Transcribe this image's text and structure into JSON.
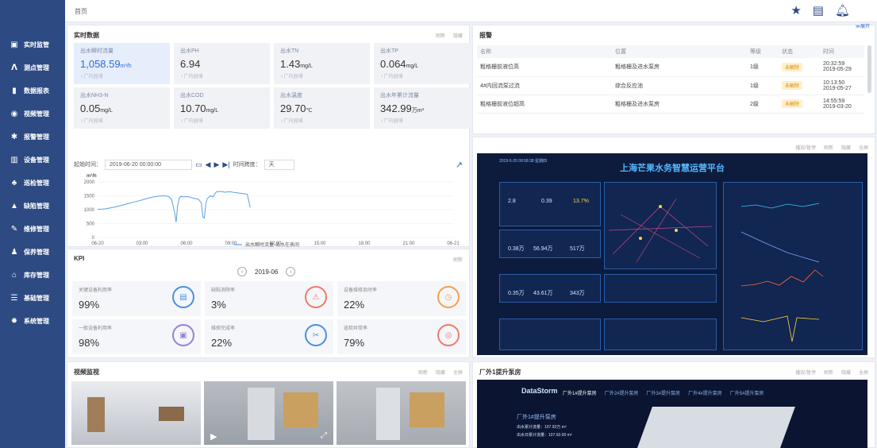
{
  "header": {
    "breadcrumb": "首页"
  },
  "sidebar": {
    "items": [
      {
        "label": "实时监管",
        "icon": "monitor-icon",
        "glyph": "▣"
      },
      {
        "label": "测点管理",
        "icon": "pulse-icon",
        "glyph": "ᐱ"
      },
      {
        "label": "数据报表",
        "icon": "bar-chart-icon",
        "glyph": "▮"
      },
      {
        "label": "视频管理",
        "icon": "camera-icon",
        "glyph": "◉"
      },
      {
        "label": "报警管理",
        "icon": "alarm-light-icon",
        "glyph": "✱"
      },
      {
        "label": "设备管理",
        "icon": "device-icon",
        "glyph": "▥"
      },
      {
        "label": "巡检管理",
        "icon": "inspection-icon",
        "glyph": "♣"
      },
      {
        "label": "缺陷管理",
        "icon": "warning-icon",
        "glyph": "▲"
      },
      {
        "label": "维修管理",
        "icon": "wrench-icon",
        "glyph": "✎"
      },
      {
        "label": "保养管理",
        "icon": "person-icon",
        "glyph": "♟"
      },
      {
        "label": "库存管理",
        "icon": "home-icon",
        "glyph": "⌂"
      },
      {
        "label": "基础管理",
        "icon": "list-icon",
        "glyph": "☰"
      },
      {
        "label": "系统管理",
        "icon": "gear-icon",
        "glyph": "✹"
      }
    ]
  },
  "realtime": {
    "title": "实时数据",
    "actions": [
      "刷新",
      "隐藏"
    ],
    "cards": [
      {
        "label": "出水瞬时流量",
        "value": "1,058.59",
        "unit": "m³/h",
        "loc": "♀广内园埔"
      },
      {
        "label": "出水PH",
        "value": "6.94",
        "unit": "",
        "loc": "♀广内园埔"
      },
      {
        "label": "出水TN",
        "value": "1.43",
        "unit": "mg/L",
        "loc": "♀广内园埔"
      },
      {
        "label": "出水TP",
        "value": "0.064",
        "unit": "mg/L",
        "loc": "♀广内园埔"
      },
      {
        "label": "出水NH3-N",
        "value": "0.05",
        "unit": "mg/L",
        "loc": "♀广内园埔"
      },
      {
        "label": "出水COD",
        "value": "10.70",
        "unit": "mg/L",
        "loc": "♀广内园埔"
      },
      {
        "label": "出水温度",
        "value": "29.70",
        "unit": "℃",
        "loc": "♀广内园埔"
      },
      {
        "label": "出水年累计流量",
        "value": "342.99",
        "unit": "万m³",
        "loc": "♀广内园埔"
      }
    ],
    "start_label": "起始时间：",
    "start_value": "2019-06-20 00:00:00",
    "span_label": "时间跨度：",
    "span_value": "天"
  },
  "chart_data": {
    "type": "line",
    "ylabel": "m³/h",
    "ylim": [
      0,
      2000
    ],
    "yticks": [
      0,
      500,
      1000,
      1500,
      2000
    ],
    "xticks": [
      "06-20",
      "03:00",
      "06:00",
      "09:00",
      "12:00",
      "15:00",
      "18:00",
      "21:00",
      "06-21"
    ],
    "series": [
      {
        "name": "出水瞬时流量-出水在表间",
        "x": [
          0,
          0.5,
          1.0,
          1.5,
          2.0,
          2.5,
          3.0,
          3.3,
          3.6,
          3.9,
          4.2,
          4.5,
          4.8,
          5.0,
          5.2,
          5.3,
          5.4,
          5.5,
          5.6,
          5.8,
          6.0,
          6.2,
          6.4,
          6.6,
          6.8,
          7.0,
          7.1,
          7.2,
          7.3,
          7.4,
          7.6,
          7.8,
          8.0,
          8.3,
          8.6,
          8.9,
          9.2,
          9.5,
          9.8,
          10.1,
          10.3
        ],
        "y": [
          1010,
          1030,
          1080,
          1140,
          1210,
          1280,
          1350,
          1400,
          1440,
          1470,
          1490,
          1500,
          1480,
          1360,
          900,
          550,
          1150,
          1400,
          1480,
          1460,
          1470,
          1460,
          1420,
          1400,
          1380,
          1250,
          750,
          700,
          1200,
          1400,
          1500,
          1460,
          1640,
          1660,
          1630,
          1650,
          1620,
          1600,
          1580,
          1560,
          1080
        ]
      }
    ]
  },
  "kpi": {
    "title": "KPI",
    "action": "刷新",
    "month": "2019-06",
    "items": [
      {
        "label": "关键设备利用率",
        "value": "99%",
        "icon": "doc-icon",
        "glyph": "▤",
        "color": "#4b8fe0"
      },
      {
        "label": "缺陷消除率",
        "value": "3%",
        "icon": "warning-icon",
        "glyph": "⚠",
        "color": "#f07a6a"
      },
      {
        "label": "设备维修及时率",
        "value": "22%",
        "icon": "clock-icon",
        "glyph": "◷",
        "color": "#f2a24a"
      },
      {
        "label": "一般设备利用率",
        "value": "98%",
        "icon": "card-icon",
        "glyph": "▣",
        "color": "#9b7fd6"
      },
      {
        "label": "维修完成率",
        "value": "22%",
        "icon": "tools-icon",
        "glyph": "✂",
        "color": "#4b8fe0"
      },
      {
        "label": "巡检异常率",
        "value": "79%",
        "icon": "target-icon",
        "glyph": "◎",
        "color": "#f07a6a"
      }
    ]
  },
  "alarm": {
    "title": "报警",
    "expand": "≫展开",
    "columns": [
      "名称",
      "位置",
      "等级",
      "状态",
      "时间"
    ],
    "rows": [
      {
        "name": "粗格栅前液位高",
        "loc": "粗格栅及进水泵房",
        "level": "1级",
        "status": "未解除",
        "time1": "20:32:59",
        "time2": "2019-05-29"
      },
      {
        "name": "4#内回流泵过流",
        "loc": "综合反应池",
        "level": "1级",
        "status": "未解除",
        "time1": "10:13:50",
        "time2": "2019-05-27"
      },
      {
        "name": "粗格栅前液位超高",
        "loc": "粗格栅及进水泵房",
        "level": "2级",
        "status": "未解除",
        "time1": "14:55:59",
        "time2": "2019-03-20"
      }
    ]
  },
  "screen": {
    "title": "上海芒果水务智慧运营平台",
    "date": "2019-5-20 09:58:38 星期四",
    "actions": [
      "播放/暂停",
      "刷新",
      "隐藏",
      "全屏"
    ],
    "nums": [
      "2.8",
      "0.39",
      "13.7%",
      "0.38万",
      "56.94万",
      "517万",
      "0.35万",
      "43.61万",
      "343万"
    ]
  },
  "video": {
    "title": "视频监视",
    "actions": [
      "刷新",
      "隐藏",
      "全屏"
    ]
  },
  "station": {
    "title": "厂外1提升泵房",
    "actions": [
      "播放/暂停",
      "刷新",
      "隐藏",
      "全屏"
    ],
    "brand": "DataStorm",
    "tabs": [
      "厂外1#提升泵房",
      "厂外2#提升泵房",
      "厂外3#提升泵房",
      "厂外4#提升泵房",
      "厂外5#提升泵房"
    ],
    "subtitle": "厂外1#提升泵房",
    "lines": [
      "出水累计流量：107.92万 m³",
      "出水日累计流量：107.92.00 m³"
    ]
  },
  "colors": {
    "sidebar": "#2e4a82",
    "accent": "#2f6bd6",
    "line": "#5aa0e6"
  }
}
